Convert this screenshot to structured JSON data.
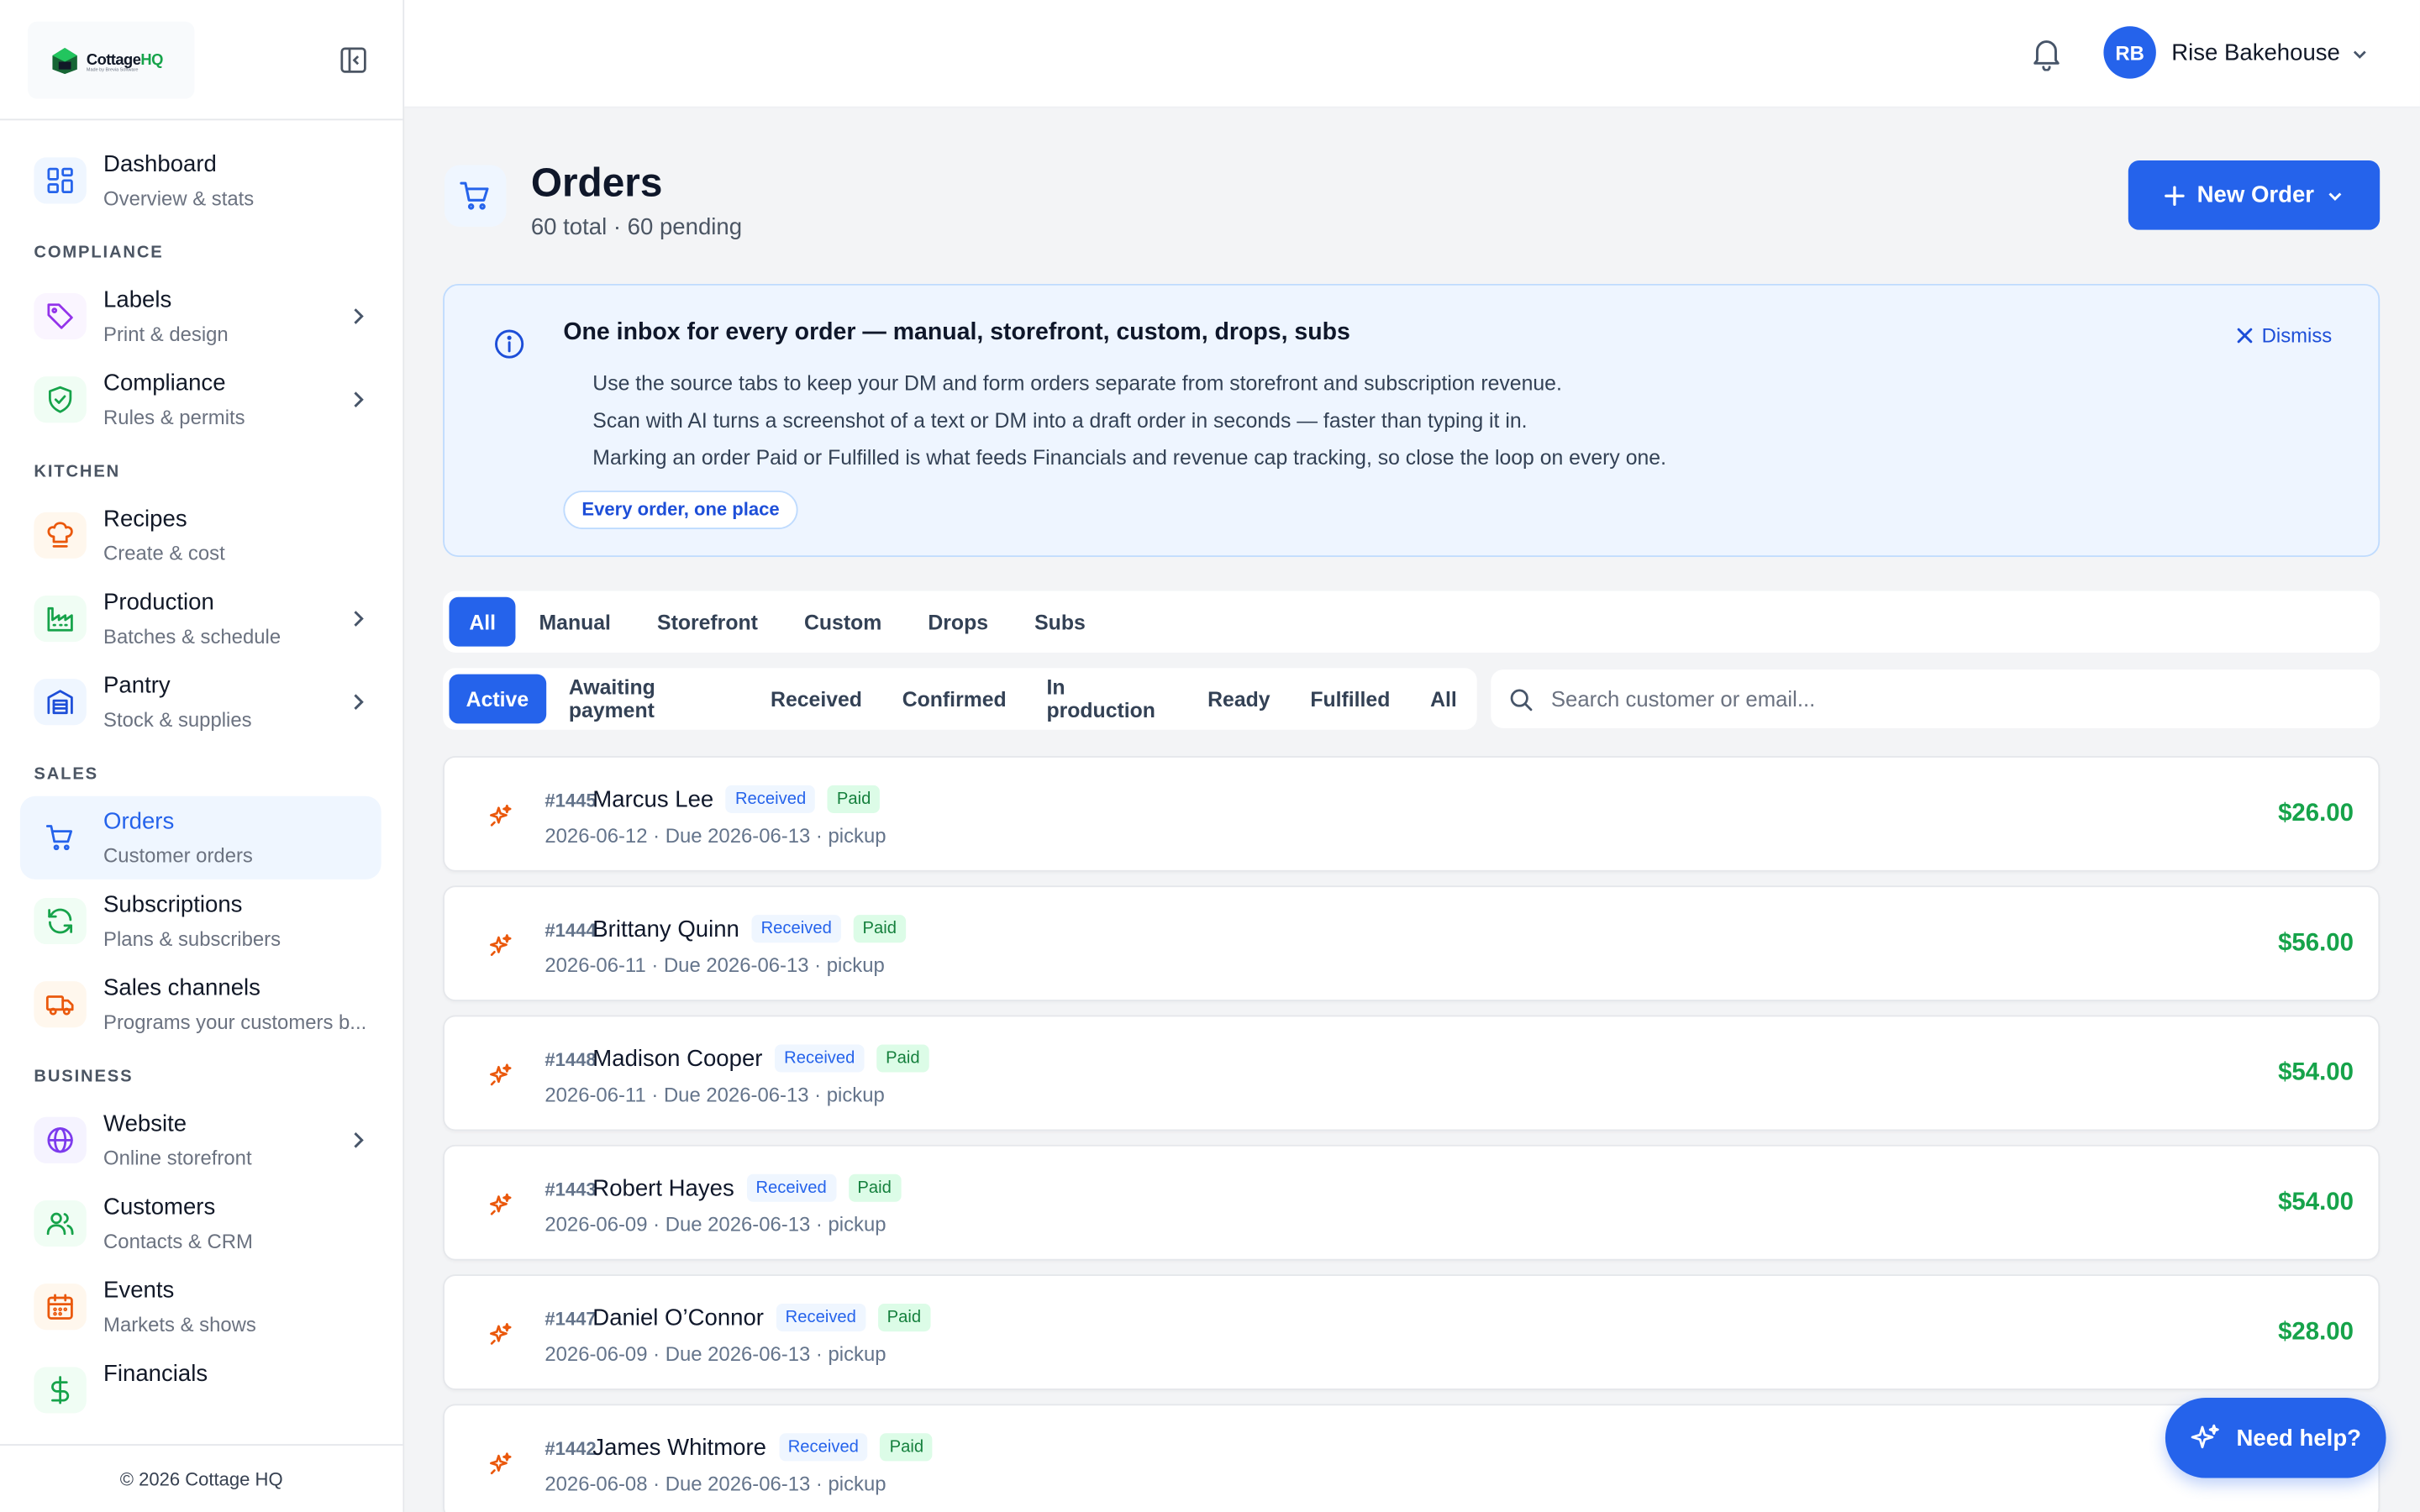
{
  "sidebar": {
    "logo": {
      "brand": "Cottage",
      "brand_accent": "HQ",
      "tagline": "Made by Brevia Software"
    },
    "sections": [
      {
        "title": "",
        "items": [
          {
            "label": "Dashboard",
            "sub": "Overview & stats",
            "icon": "dashboard-icon",
            "color": "#2563eb",
            "bg": "#eff6ff",
            "chevron": false,
            "active": false
          }
        ]
      },
      {
        "title": "COMPLIANCE",
        "items": [
          {
            "label": "Labels",
            "sub": "Print & design",
            "icon": "tag-icon",
            "color": "#9333ea",
            "bg": "#faf5ff",
            "chevron": true,
            "active": false
          },
          {
            "label": "Compliance",
            "sub": "Rules & permits",
            "icon": "shield-check-icon",
            "color": "#16a34a",
            "bg": "#f0fdf4",
            "chevron": true,
            "active": false
          }
        ]
      },
      {
        "title": "KITCHEN",
        "items": [
          {
            "label": "Recipes",
            "sub": "Create & cost",
            "icon": "chef-hat-icon",
            "color": "#ea580c",
            "bg": "#fff7ed",
            "chevron": false,
            "active": false
          },
          {
            "label": "Production",
            "sub": "Batches & schedule",
            "icon": "factory-icon",
            "color": "#16a34a",
            "bg": "#f0fdf4",
            "chevron": true,
            "active": false
          },
          {
            "label": "Pantry",
            "sub": "Stock & supplies",
            "icon": "warehouse-icon",
            "color": "#1d4ed8",
            "bg": "#eff6ff",
            "chevron": true,
            "active": false
          }
        ]
      },
      {
        "title": "SALES",
        "items": [
          {
            "label": "Orders",
            "sub": "Customer orders",
            "icon": "cart-icon",
            "color": "#2563eb",
            "bg": "transparent",
            "chevron": false,
            "active": true
          },
          {
            "label": "Subscriptions",
            "sub": "Plans & subscribers",
            "icon": "refresh-icon",
            "color": "#16a34a",
            "bg": "#f0fdf4",
            "chevron": false,
            "active": false
          },
          {
            "label": "Sales channels",
            "sub": "Programs your customers b...",
            "icon": "truck-icon",
            "color": "#ea580c",
            "bg": "#fff7ed",
            "chevron": false,
            "active": false
          }
        ]
      },
      {
        "title": "BUSINESS",
        "items": [
          {
            "label": "Website",
            "sub": "Online storefront",
            "icon": "globe-icon",
            "color": "#7c3aed",
            "bg": "#f5f3ff",
            "chevron": true,
            "active": false
          },
          {
            "label": "Customers",
            "sub": "Contacts & CRM",
            "icon": "users-icon",
            "color": "#16a34a",
            "bg": "#f0fdf4",
            "chevron": false,
            "active": false
          },
          {
            "label": "Events",
            "sub": "Markets & shows",
            "icon": "calendar-icon",
            "color": "#ea580c",
            "bg": "#fff7ed",
            "chevron": false,
            "active": false
          },
          {
            "label": "Financials",
            "sub": "",
            "icon": "dollar-icon",
            "color": "#16a34a",
            "bg": "#f0fdf4",
            "chevron": false,
            "active": false
          }
        ]
      }
    ],
    "footer": "© 2026 Cottage HQ"
  },
  "topbar": {
    "avatar_initials": "RB",
    "account_name": "Rise Bakehouse"
  },
  "page": {
    "title": "Orders",
    "subtitle": "60 total · 60 pending",
    "new_order_label": "New Order"
  },
  "banner": {
    "title": "One inbox for every order — manual, storefront, custom, drops, subs",
    "lines": [
      "Use the source tabs to keep your DM and form orders separate from storefront and subscription revenue.",
      "Scan with AI turns a screenshot of a text or DM into a draft order in seconds — faster than typing it in.",
      "Marking an order Paid or Fulfilled is what feeds Financials and revenue cap tracking, so close the loop on every one."
    ],
    "pill": "Every order, one place",
    "dismiss": "Dismiss"
  },
  "source_tabs": [
    {
      "label": "All",
      "active": true
    },
    {
      "label": "Manual",
      "active": false
    },
    {
      "label": "Storefront",
      "active": false
    },
    {
      "label": "Custom",
      "active": false
    },
    {
      "label": "Drops",
      "active": false
    },
    {
      "label": "Subs",
      "active": false
    }
  ],
  "status_tabs": [
    {
      "label": "Active",
      "active": true
    },
    {
      "label": "Awaiting payment",
      "active": false
    },
    {
      "label": "Received",
      "active": false
    },
    {
      "label": "Confirmed",
      "active": false
    },
    {
      "label": "In production",
      "active": false
    },
    {
      "label": "Ready",
      "active": false
    },
    {
      "label": "Fulfilled",
      "active": false
    },
    {
      "label": "All",
      "active": false
    }
  ],
  "search": {
    "placeholder": "Search customer or email..."
  },
  "orders": [
    {
      "number": "#1445",
      "name": "Marcus Lee",
      "status": "Received",
      "payment": "Paid",
      "meta": "2026-06-12 · Due 2026-06-13 · pickup",
      "amount": "$26.00"
    },
    {
      "number": "#1444",
      "name": "Brittany Quinn",
      "status": "Received",
      "payment": "Paid",
      "meta": "2026-06-11 · Due 2026-06-13 · pickup",
      "amount": "$56.00"
    },
    {
      "number": "#1448",
      "name": "Madison Cooper",
      "status": "Received",
      "payment": "Paid",
      "meta": "2026-06-11 · Due 2026-06-13 · pickup",
      "amount": "$54.00"
    },
    {
      "number": "#1443",
      "name": "Robert Hayes",
      "status": "Received",
      "payment": "Paid",
      "meta": "2026-06-09 · Due 2026-06-13 · pickup",
      "amount": "$54.00"
    },
    {
      "number": "#1447",
      "name": "Daniel O’Connor",
      "status": "Received",
      "payment": "Paid",
      "meta": "2026-06-09 · Due 2026-06-13 · pickup",
      "amount": "$28.00"
    },
    {
      "number": "#1442",
      "name": "James Whitmore",
      "status": "Received",
      "payment": "Paid",
      "meta": "2026-06-08 · Due 2026-06-13 · pickup",
      "amount": ""
    }
  ],
  "help_button": "Need help?",
  "colors": {
    "primary": "#2563eb",
    "success": "#16a34a",
    "order_icon": "#ea580c"
  }
}
